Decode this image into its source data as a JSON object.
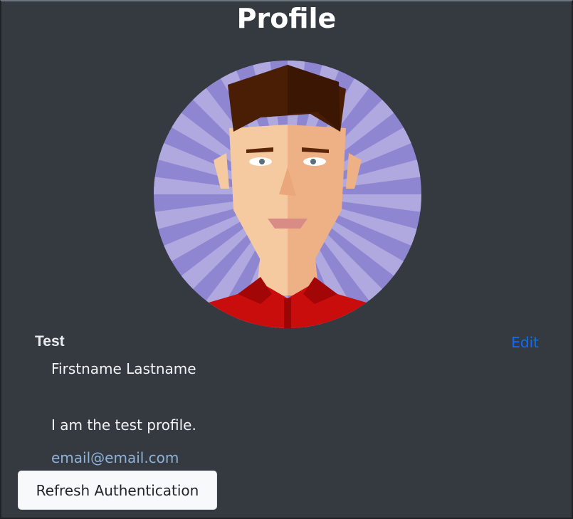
{
  "header": {
    "title": "Profile"
  },
  "profile": {
    "avatar_icon": "male-cartoon-avatar",
    "username": "Test",
    "edit_label": "Edit",
    "full_name": "Firstname Lastname",
    "bio": "I am the test profile.",
    "email": "email@email.com"
  },
  "actions": {
    "refresh_label": "Refresh Authentication"
  },
  "colors": {
    "background": "#343a40",
    "link": "#0d6efd",
    "email": "#8fb2d6",
    "button_bg": "#f8f9fa"
  }
}
